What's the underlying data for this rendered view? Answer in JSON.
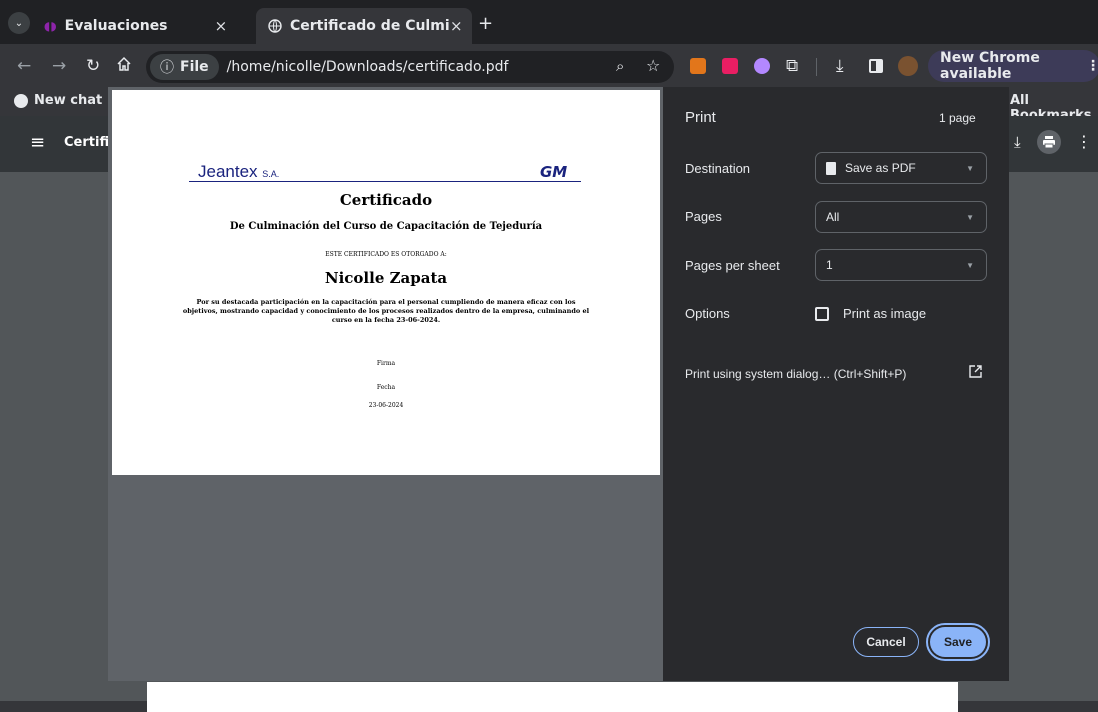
{
  "tabs": [
    {
      "title": "Evaluaciones",
      "active": false
    },
    {
      "title": "Certificado de Culminac",
      "active": true
    }
  ],
  "new_tab_symbol": "+",
  "tab_close_symbol": "×",
  "address": {
    "scheme_label": "File",
    "url": "/home/nicolle/Downloads/certificado.pdf"
  },
  "new_chrome_label": "New Chrome available",
  "bookmarks": {
    "left_item": "New chat",
    "right_item": "All Bookmarks"
  },
  "pdf_title": "Certific",
  "print": {
    "title": "Print",
    "page_count": "1 page",
    "destination_label": "Destination",
    "destination_value": "Save as PDF",
    "pages_label": "Pages",
    "pages_value": "All",
    "pps_label": "Pages per sheet",
    "pps_value": "1",
    "options_label": "Options",
    "print_as_image_label": "Print as image",
    "print_as_image_checked": false,
    "system_dialog_label": "Print using system dialog… (Ctrl+Shift+P)",
    "cancel_label": "Cancel",
    "save_label": "Save",
    "accent_color": "#8ab4f8"
  },
  "certificate": {
    "company_logo": "Jeantex",
    "company_suffix": "S.A.",
    "partner_logo": "GM",
    "title": "Certificado",
    "subtitle": "De Culminación del Curso de Capacitación de Tejeduría",
    "awarded_to_label": "ESTE CERTIFICADO ES OTORGADO A:",
    "recipient": "Nicolle Zapata",
    "body_line1": "Por su destacada participación en la capacitación para el personal cumpliendo de manera eficaz con los",
    "body_line2": "objetivos, mostrando capacidad y conocimiento de los procesos realizados dentro de la empresa, culminando el",
    "body_line3": "curso en la fecha 23-06-2024.",
    "firma_label": "Firma",
    "fecha_label": "Fecha",
    "fecha_value": "23-06-2024"
  }
}
